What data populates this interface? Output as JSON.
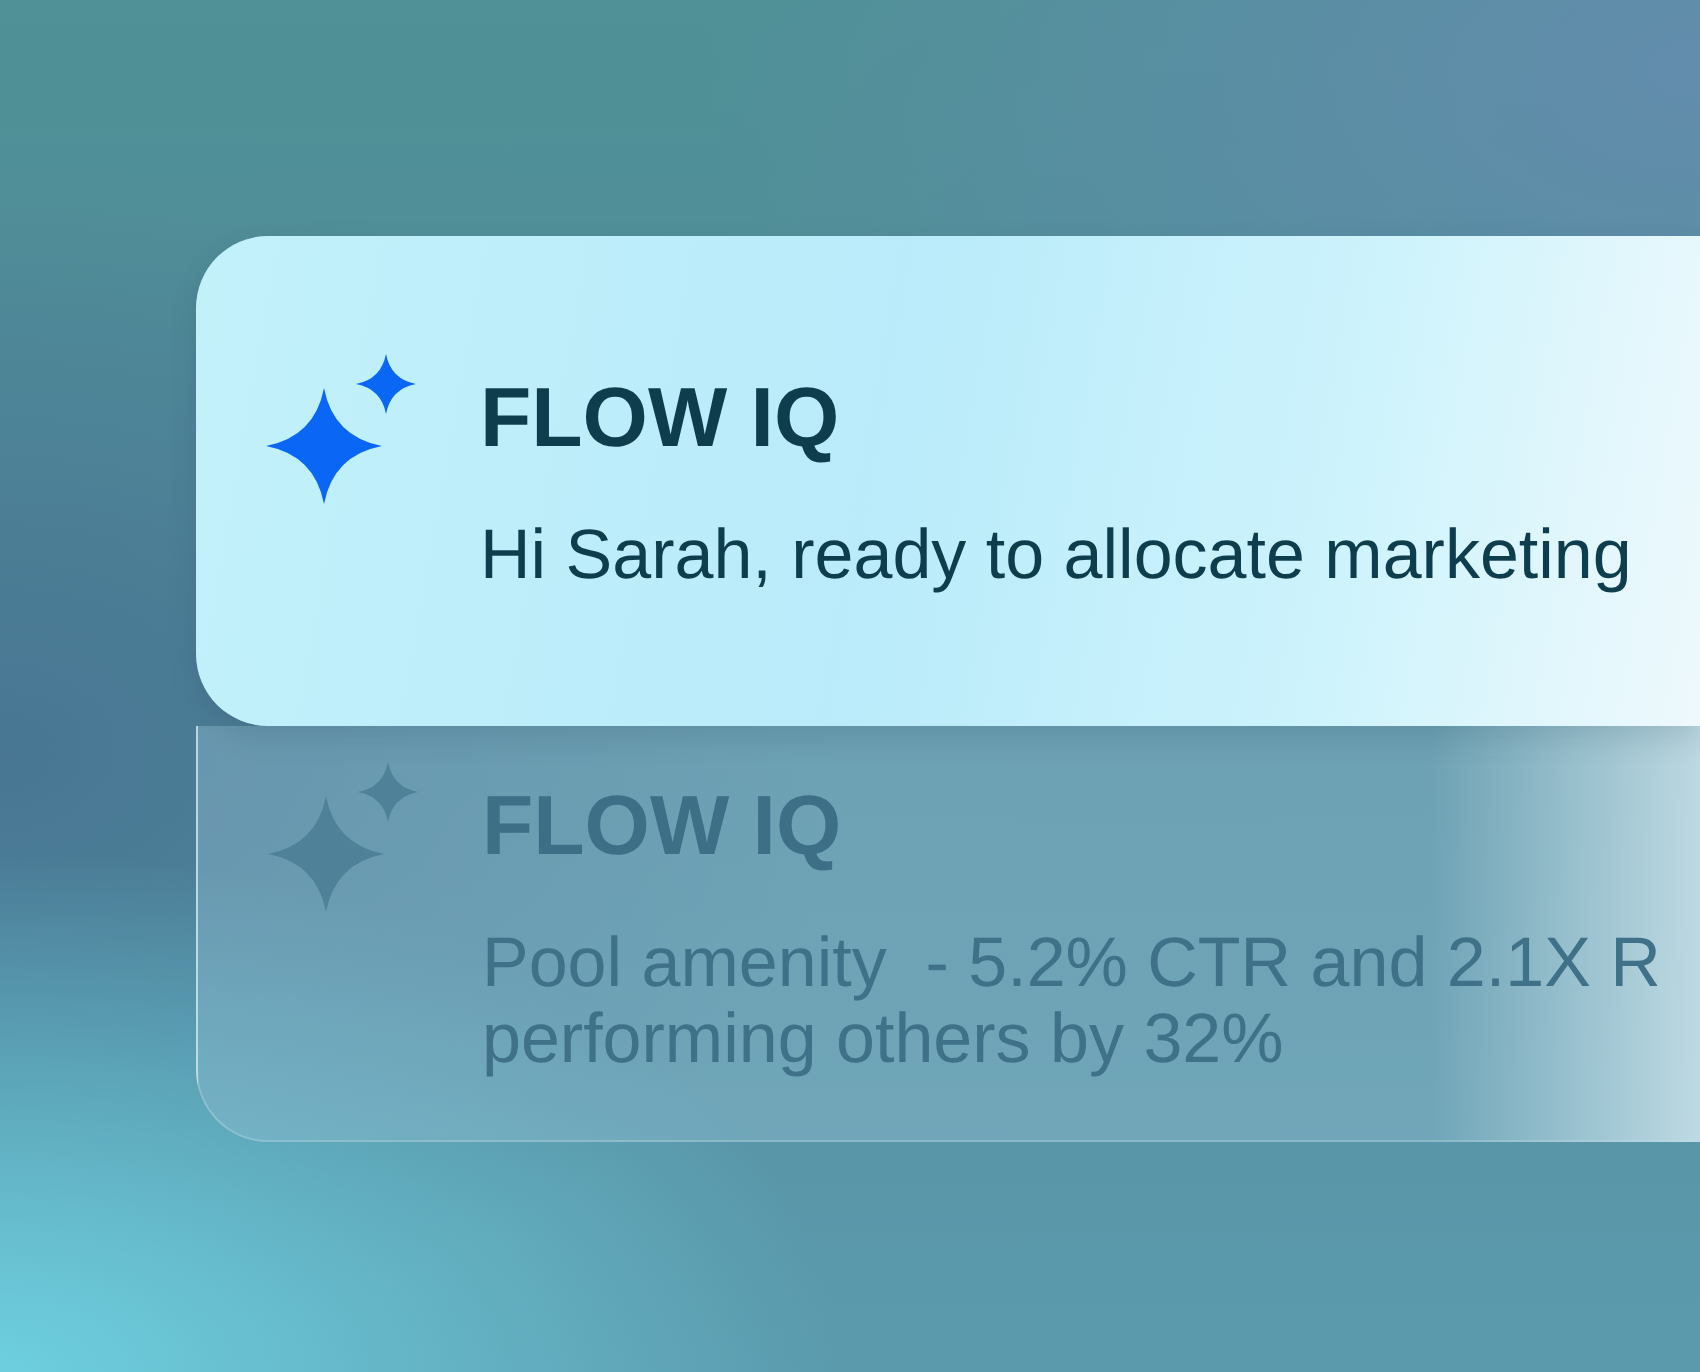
{
  "notifications": [
    {
      "app_name": "FLOW IQ",
      "message_lines": [
        "Hi Sarah, ready to allocate marketing"
      ],
      "faded": false
    },
    {
      "app_name": "FLOW IQ",
      "message_lines": [
        "Pool amenity  - 5.2% CTR and 2.1X R",
        "performing others by 32%"
      ],
      "faded": true
    }
  ]
}
